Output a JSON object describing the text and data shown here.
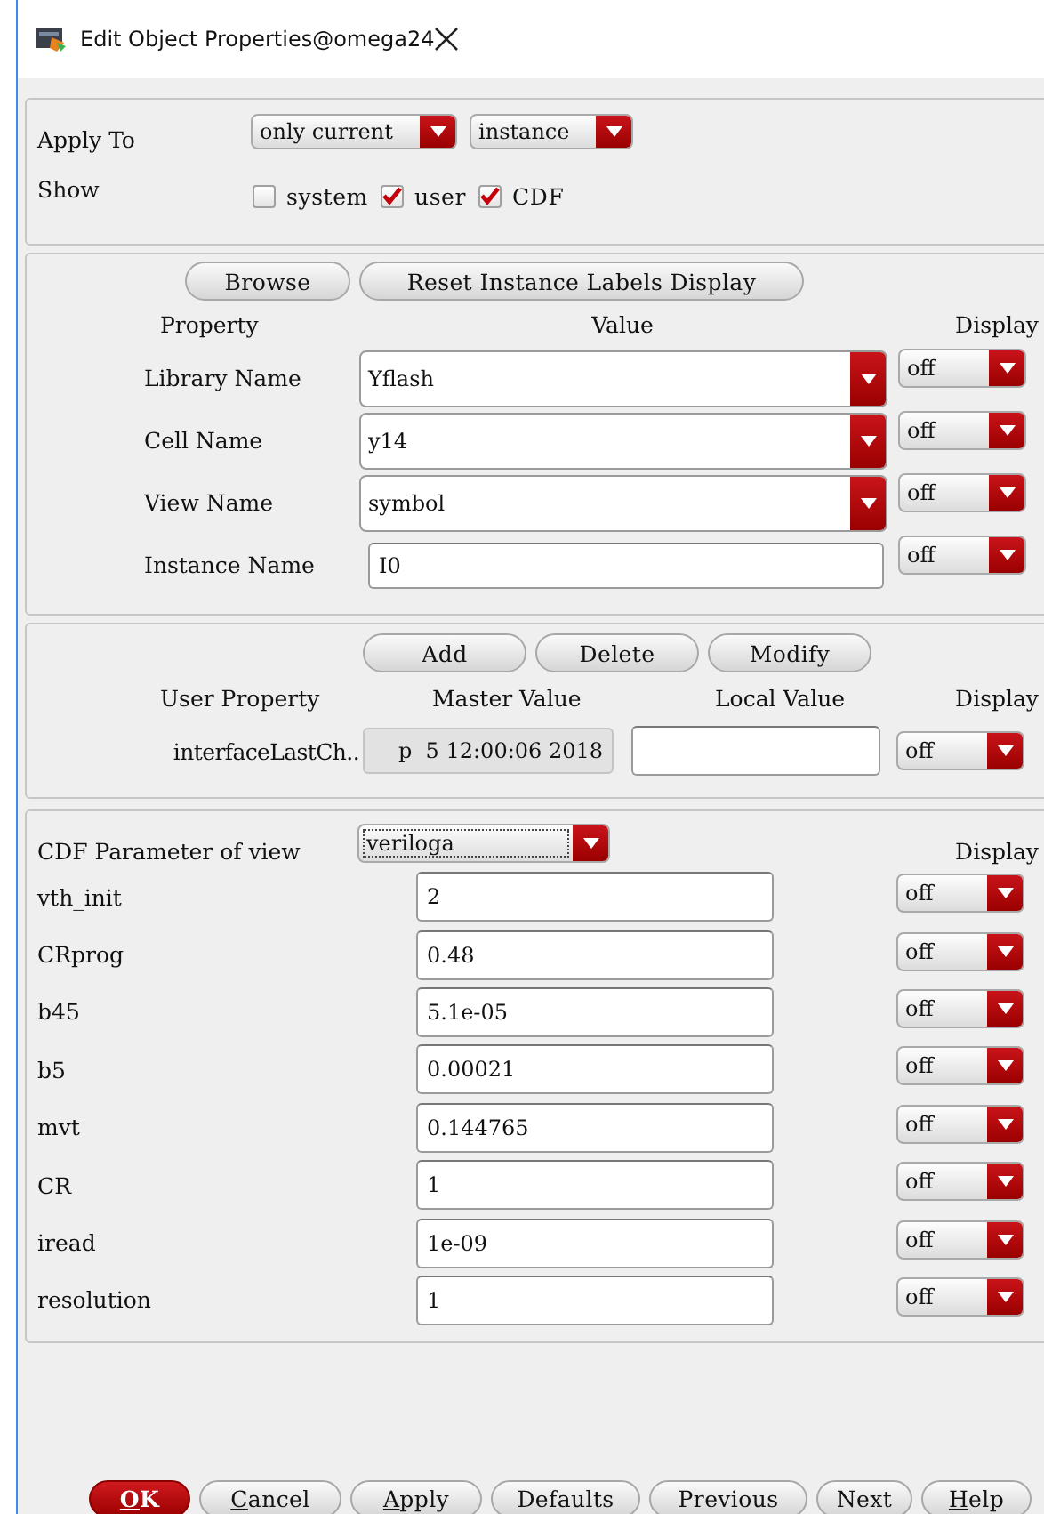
{
  "window": {
    "title": "Edit Object Properties@omega24"
  },
  "apply_to": {
    "label": "Apply To",
    "scope": "only current",
    "target": "instance"
  },
  "show": {
    "label": "Show",
    "options": [
      {
        "label": "system",
        "checked": false
      },
      {
        "label": "user",
        "checked": true
      },
      {
        "label": "CDF",
        "checked": true
      }
    ]
  },
  "properties": {
    "buttons": [
      "Browse",
      "Reset Instance Labels Display"
    ],
    "columns": [
      "Property",
      "Value",
      "Display"
    ],
    "rows": [
      {
        "name": "Library Name",
        "value": "Yflash",
        "kind": "dropdown",
        "display": "off"
      },
      {
        "name": "Cell Name",
        "value": "y14",
        "kind": "dropdown",
        "display": "off"
      },
      {
        "name": "View Name",
        "value": "symbol",
        "kind": "dropdown",
        "display": "off"
      },
      {
        "name": "Instance Name",
        "value": "I0",
        "kind": "text",
        "display": "off"
      }
    ]
  },
  "user_properties": {
    "buttons": [
      "Add",
      "Delete",
      "Modify"
    ],
    "columns": [
      "User Property",
      "Master Value",
      "Local Value",
      "Display"
    ],
    "rows": [
      {
        "name": "interfaceLastCh..",
        "master_value": "p  5 12:00:06 2018",
        "display": "off"
      }
    ]
  },
  "cdf": {
    "label": "CDF Parameter of view",
    "view": "veriloga",
    "column": "Display",
    "rows": [
      {
        "name": "vth_init",
        "value": "2",
        "display": "off"
      },
      {
        "name": "CRprog",
        "value": "0.48",
        "display": "off"
      },
      {
        "name": "b45",
        "value": "5.1e-05",
        "display": "off"
      },
      {
        "name": "b5",
        "value": "0.00021",
        "display": "off"
      },
      {
        "name": "mvt",
        "value": "0.144765",
        "display": "off"
      },
      {
        "name": "CR",
        "value": "1",
        "display": "off"
      },
      {
        "name": "iread",
        "value": "1e-09",
        "display": "off"
      },
      {
        "name": "resolution",
        "value": "1",
        "display": "off"
      }
    ]
  },
  "buttons": [
    {
      "mnemonic": "O",
      "text": "K",
      "kind": "default"
    },
    {
      "mnemonic": "C",
      "text": "ancel",
      "kind": "normal"
    },
    {
      "mnemonic": "A",
      "text": "pply",
      "kind": "normal"
    },
    {
      "text": "Defaults",
      "kind": "normal"
    },
    {
      "text": "Previous",
      "kind": "normal"
    },
    {
      "text": "Next",
      "kind": "normal"
    },
    {
      "mnemonic": "H",
      "text": "elp",
      "kind": "normal"
    }
  ]
}
